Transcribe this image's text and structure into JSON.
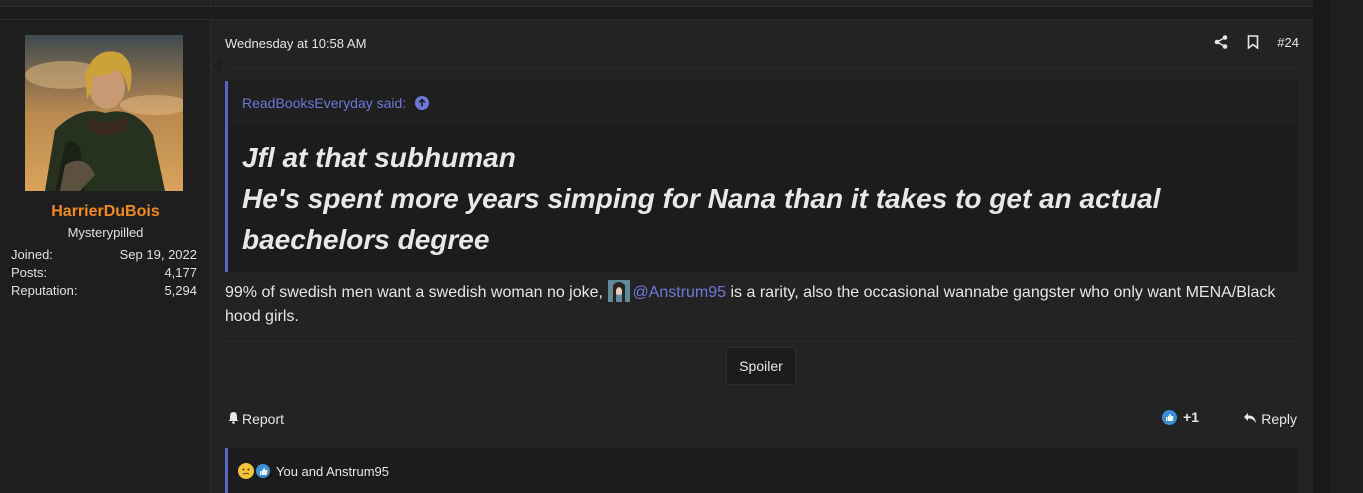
{
  "user": {
    "name": "HarrierDuBois",
    "title": "Mysterypilled",
    "stats": [
      {
        "label": "Joined:",
        "value": "Sep 19, 2022"
      },
      {
        "label": "Posts:",
        "value": "4,177"
      },
      {
        "label": "Reputation:",
        "value": "5,294"
      }
    ]
  },
  "post": {
    "date": "Wednesday at 10:58 AM",
    "number": "#24",
    "quote": {
      "author": "ReadBooksEveryday said:",
      "lines": [
        "Jfl at that subhuman",
        "He's spent more years simping for Nana than it takes to get an actual",
        "baechelors degree"
      ]
    },
    "body": {
      "before": "99% of swedish men want a swedish woman no joke,",
      "mention": "@Anstrum95",
      "after": "is a rarity, also the occasional wannabe gangster who only want MENA/Black hood girls."
    },
    "spoiler_label": "Spoiler",
    "report_label": "Report",
    "reaction_count": "+1",
    "reply_label": "Reply",
    "reactions_text": "You and Anstrum95"
  },
  "colors": {
    "accent": "#5a63c9",
    "username": "#f28b1c",
    "link": "#6f78d6"
  },
  "icons": [
    "share-icon",
    "bookmark-icon",
    "up-arrow-icon",
    "bell-icon",
    "like-icon",
    "reply-icon",
    "thinking-emoji-icon"
  ]
}
